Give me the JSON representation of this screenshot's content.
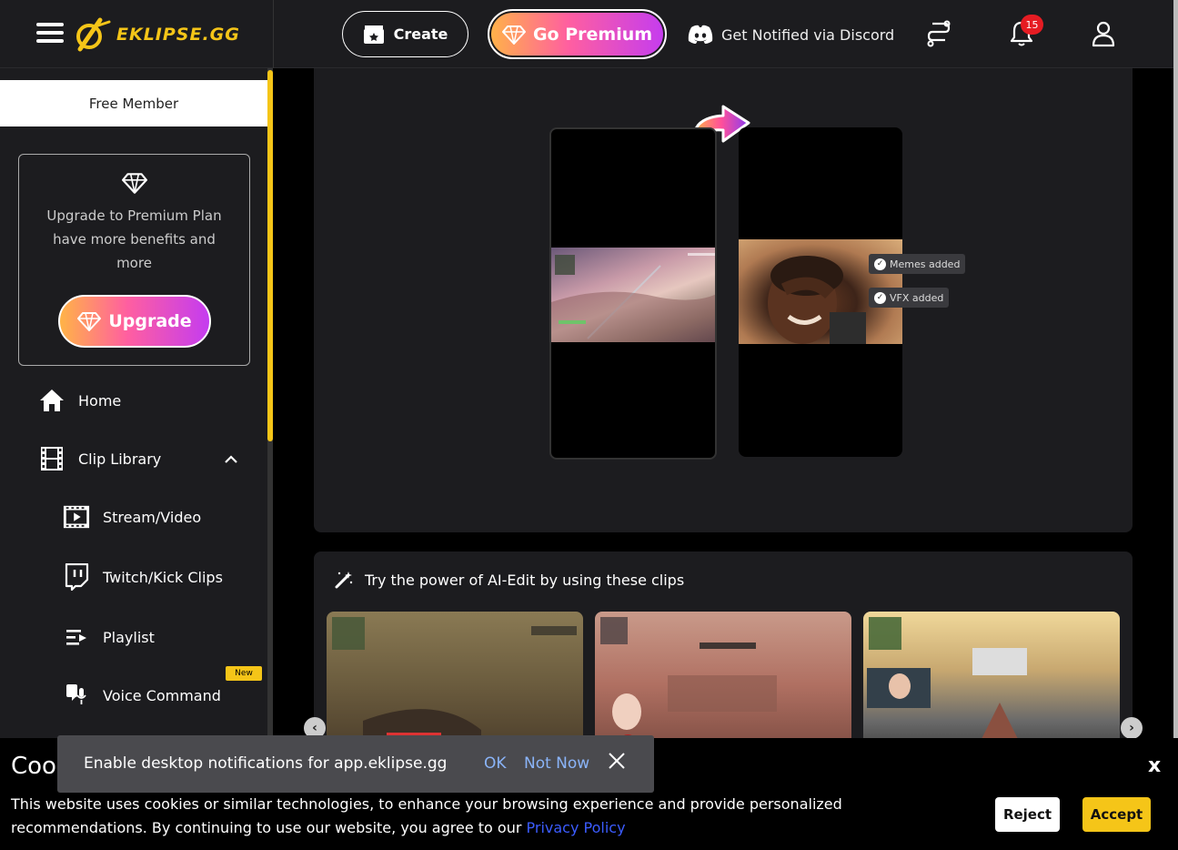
{
  "brand": {
    "name": "EKLIPSE.GG",
    "accent": "#f5c518"
  },
  "header": {
    "create_label": "Create",
    "premium_label": "Go Premium",
    "discord_label": "Get Notified via Discord",
    "notification_count": "15"
  },
  "sidebar": {
    "member_status": "Free Member",
    "upgrade_text": "Upgrade to Premium Plan have more benefits and more",
    "upgrade_label": "Upgrade",
    "nav": {
      "home": "Home",
      "clip_library": "Clip Library",
      "stream_video": "Stream/Video",
      "twitch_kick": "Twitch/Kick Clips",
      "playlist": "Playlist",
      "voice_command": "Voice Command",
      "new_badge": "New"
    }
  },
  "hero": {
    "tag_memes": "Memes added",
    "tag_vfx": "VFX added"
  },
  "clips": {
    "title": "Try the power of AI-Edit by using these clips"
  },
  "notification_prompt": {
    "text": "Enable desktop notifications for app.eklipse.gg",
    "ok": "OK",
    "not_now": "Not Now"
  },
  "cookie": {
    "title": "Coo",
    "text": "This website uses cookies or similar technologies, to enhance your browsing experience and provide personalized recommendations. By continuing to use our website, you agree to our ",
    "link": "Privacy Policy",
    "close": "x",
    "reject": "Reject",
    "accept": "Accept"
  }
}
